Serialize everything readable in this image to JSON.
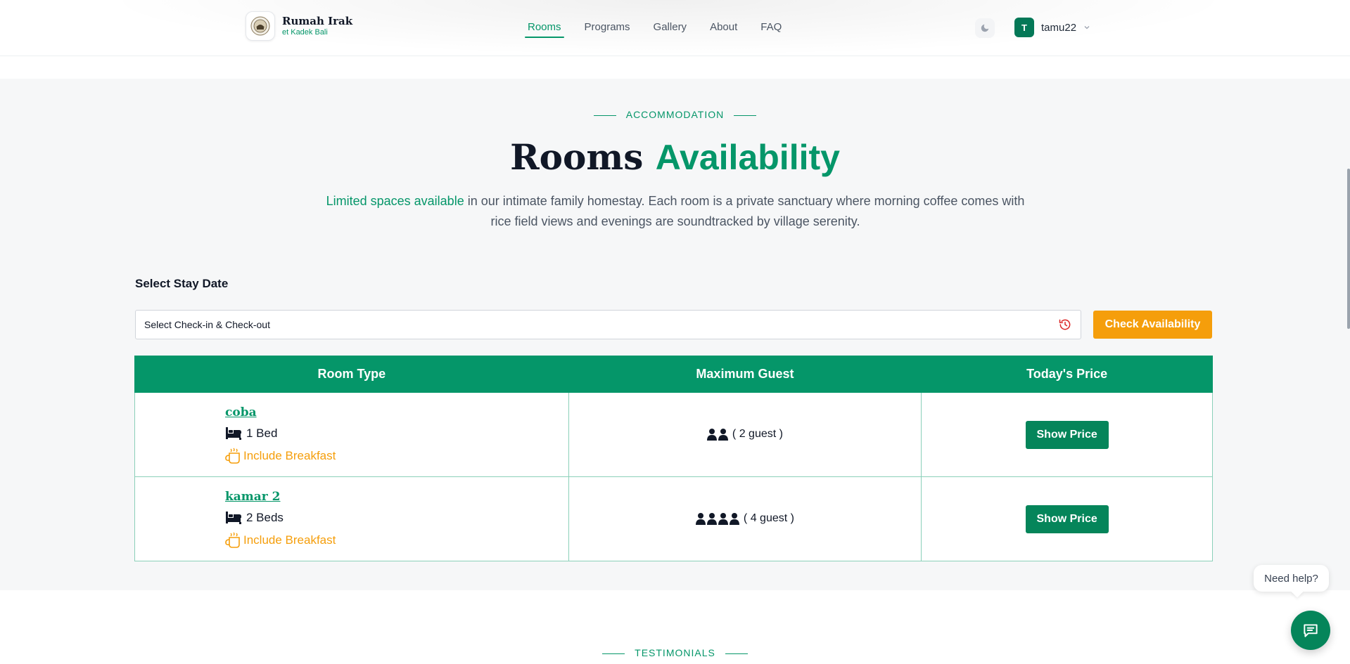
{
  "brand": {
    "title": "Rumah Irak",
    "subtitle": "et Kadek Bali"
  },
  "nav": {
    "items": [
      {
        "label": "Rooms",
        "active": true
      },
      {
        "label": "Programs",
        "active": false
      },
      {
        "label": "Gallery",
        "active": false
      },
      {
        "label": "About",
        "active": false
      },
      {
        "label": "FAQ",
        "active": false
      }
    ]
  },
  "header_actions": {
    "theme_icon": "moon-icon",
    "avatar_initial": "T",
    "username": "tamu22",
    "menu_icon": "chevron-down-icon"
  },
  "section": {
    "eyebrow": "ACCOMMODATION",
    "heading_part1": "Rooms",
    "heading_part2": "Availability",
    "intro_highlight": "Limited spaces available",
    "intro_rest": " in our intimate family homestay. Each room is a private sanctuary where morning coffee comes with rice field views and evenings are soundtracked by village serenity."
  },
  "booking": {
    "label": "Select Stay Date",
    "placeholder": "Select Check-in & Check-out",
    "reset_icon": "history-icon",
    "check_button": "Check Availability"
  },
  "table": {
    "headers": [
      "Room Type",
      "Maximum Guest",
      "Today's Price"
    ],
    "rows": [
      {
        "name": "coba",
        "beds": "1 Bed",
        "breakfast": "Include Breakfast",
        "guest_count": 2,
        "guest_text": "( 2 guest )",
        "price_button": "Show Price"
      },
      {
        "name": "kamar 2",
        "beds": "2 Beds",
        "breakfast": "Include Breakfast",
        "guest_count": 4,
        "guest_text": "( 4 guest )",
        "price_button": "Show Price"
      }
    ]
  },
  "next_section": {
    "eyebrow": "TESTIMONIALS"
  },
  "help": {
    "bubble_text": "Need help?",
    "chat_icon": "chat-icon"
  },
  "colors": {
    "primary": "#059669",
    "button_green": "#05855a",
    "accent": "#f59e0b",
    "section_bg": "#f6f7f8"
  }
}
